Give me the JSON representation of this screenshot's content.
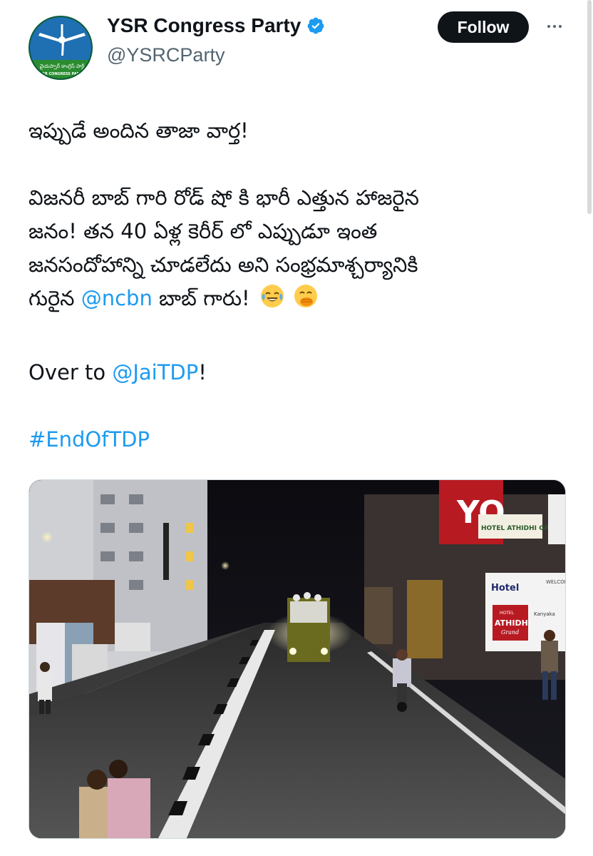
{
  "account": {
    "display_name": "YSR Congress Party",
    "handle": "@YSRCParty",
    "verified": true,
    "avatar_icon": "ysrcp-logo-fan",
    "avatar_caption_telugu": "వైయస్సార్ కాంగ్రెస్ పార్టీ",
    "avatar_caption_english": "YSR CONGRESS PARTY"
  },
  "actions": {
    "follow_label": "Follow",
    "more_icon": "more-dots-icon"
  },
  "tweet": {
    "line1": "ఇప్పుడే అందిన తాజా వార్త!",
    "para2_line1": "విజనరీ బాబ్ గారి రోడ్ షో కి భారీ ఎత్తున హాజరైన",
    "para2_line2": "జనం! తన 40 ఏళ్ల కెరీర్ లో ఎప్పుడూ ఇంత",
    "para2_line3": "జనసందోహాన్ని చూడలేదు అని సంభ్రమాశ్చర్యానికి",
    "para2_line4_prefix": "గురైన ",
    "mention_ncbn": "@ncbn",
    "para2_line4_suffix": " బాబ్ గారు!",
    "emojis": [
      "face-with-tears-of-joy",
      "face-with-hand-over-mouth"
    ],
    "over_prefix": "Over to ",
    "mention_jaitdp": "@JaiTDP",
    "over_suffix": "!",
    "hashtag": "#EndOfTDP"
  },
  "photo": {
    "description_icon": "night-road-show-photo",
    "signs": {
      "hotel_board": "HOTEL ATHIDHI GRAND",
      "hotel_small": "Hotel",
      "hotel_logo_top": "HOTEL",
      "hotel_logo_main": "ATHIDHI",
      "hotel_logo_sub": "Grand",
      "welcome": "WELCOME",
      "kanyaka": "Kanyaka",
      "big_letters": "YO"
    }
  },
  "colors": {
    "link": "#1d9bf0",
    "text": "#0f1419",
    "secondary": "#536471",
    "follow_bg": "#0f1419",
    "avatar_green": "#0a6a3c"
  }
}
